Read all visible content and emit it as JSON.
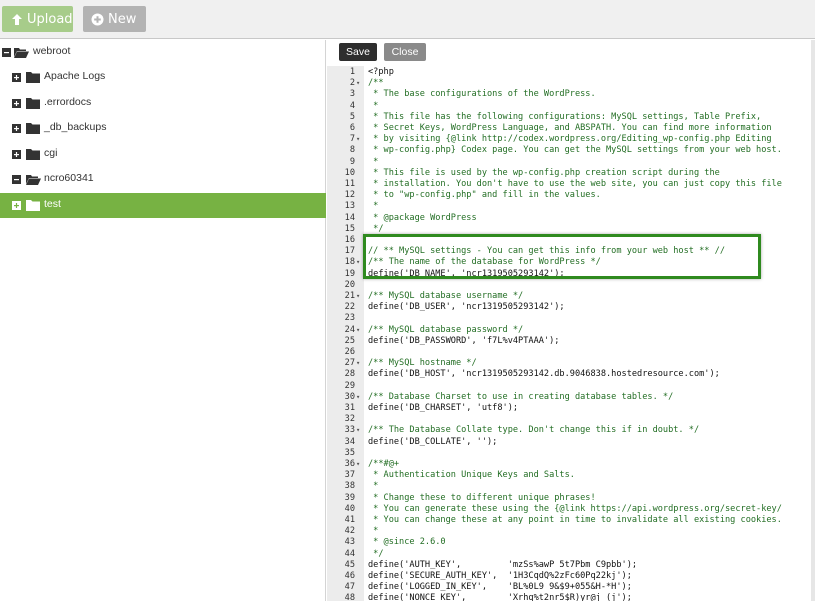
{
  "toolbar": {
    "upload_label": "Upload",
    "new_label": "New"
  },
  "tree": [
    {
      "label": "webroot",
      "level": 0,
      "open": true
    },
    {
      "label": "Apache Logs",
      "level": 1
    },
    {
      "label": ".errordocs",
      "level": 1
    },
    {
      "label": "_db_backups",
      "level": 1
    },
    {
      "label": "cgi",
      "level": 1
    },
    {
      "label": "ncro60341",
      "level": 1,
      "open": true
    },
    {
      "label": "test",
      "level": 1,
      "selected": true
    }
  ],
  "editor": {
    "save_label": "Save",
    "close_label": "Close"
  },
  "colors": {
    "accent": "#77b243",
    "highlight_border": "#2f8a1f",
    "comment": "#236e24"
  },
  "code": [
    {
      "n": "1",
      "f": "",
      "t": "<?php"
    },
    {
      "n": "2",
      "f": "▾",
      "t": "/**"
    },
    {
      "n": "3",
      "f": "",
      "t": " * The base configurations of the WordPress."
    },
    {
      "n": "4",
      "f": "",
      "t": " *"
    },
    {
      "n": "5",
      "f": "",
      "t": " * This file has the following configurations: MySQL settings, Table Prefix,"
    },
    {
      "n": "6",
      "f": "",
      "t": " * Secret Keys, WordPress Language, and ABSPATH. You can find more information"
    },
    {
      "n": "7",
      "f": "▾",
      "t": " * by visiting {@link http://codex.wordpress.org/Editing_wp-config.php Editing"
    },
    {
      "n": "8",
      "f": "",
      "t": " * wp-config.php} Codex page. You can get the MySQL settings from your web host."
    },
    {
      "n": "9",
      "f": "",
      "t": " *"
    },
    {
      "n": "10",
      "f": "",
      "t": " * This file is used by the wp-config.php creation script during the"
    },
    {
      "n": "11",
      "f": "",
      "t": " * installation. You don't have to use the web site, you can just copy this file"
    },
    {
      "n": "12",
      "f": "",
      "t": " * to \"wp-config.php\" and fill in the values."
    },
    {
      "n": "13",
      "f": "",
      "t": " *"
    },
    {
      "n": "14",
      "f": "",
      "t": " * @package WordPress"
    },
    {
      "n": "15",
      "f": "",
      "t": " */"
    },
    {
      "n": "16",
      "f": "",
      "t": ""
    },
    {
      "n": "17",
      "f": "",
      "t": "// ** MySQL settings - You can get this info from your web host ** //"
    },
    {
      "n": "18",
      "f": "▾",
      "t": "/** The name of the database for WordPress */"
    },
    {
      "n": "19",
      "f": "",
      "t": "define('DB_NAME', 'ncr1319505293142');"
    },
    {
      "n": "20",
      "f": "",
      "t": ""
    },
    {
      "n": "21",
      "f": "▾",
      "t": "/** MySQL database username */"
    },
    {
      "n": "22",
      "f": "",
      "t": "define('DB_USER', 'ncr1319505293142');"
    },
    {
      "n": "23",
      "f": "",
      "t": ""
    },
    {
      "n": "24",
      "f": "▾",
      "t": "/** MySQL database password */"
    },
    {
      "n": "25",
      "f": "",
      "t": "define('DB_PASSWORD', 'f7L%v4PTAAA');"
    },
    {
      "n": "26",
      "f": "",
      "t": ""
    },
    {
      "n": "27",
      "f": "▾",
      "t": "/** MySQL hostname */"
    },
    {
      "n": "28",
      "f": "",
      "t": "define('DB_HOST', 'ncr1319505293142.db.9046838.hostedresource.com');"
    },
    {
      "n": "29",
      "f": "",
      "t": ""
    },
    {
      "n": "30",
      "f": "▾",
      "t": "/** Database Charset to use in creating database tables. */"
    },
    {
      "n": "31",
      "f": "",
      "t": "define('DB_CHARSET', 'utf8');"
    },
    {
      "n": "32",
      "f": "",
      "t": ""
    },
    {
      "n": "33",
      "f": "▾",
      "t": "/** The Database Collate type. Don't change this if in doubt. */"
    },
    {
      "n": "34",
      "f": "",
      "t": "define('DB_COLLATE', '');"
    },
    {
      "n": "35",
      "f": "",
      "t": ""
    },
    {
      "n": "36",
      "f": "▾",
      "t": "/**#@+"
    },
    {
      "n": "37",
      "f": "",
      "t": " * Authentication Unique Keys and Salts."
    },
    {
      "n": "38",
      "f": "",
      "t": " *"
    },
    {
      "n": "39",
      "f": "",
      "t": " * Change these to different unique phrases!"
    },
    {
      "n": "40",
      "f": "",
      "t": " * You can generate these using the {@link https://api.wordpress.org/secret-key/"
    },
    {
      "n": "41",
      "f": "",
      "t": " * You can change these at any point in time to invalidate all existing cookies."
    },
    {
      "n": "42",
      "f": "",
      "t": " *"
    },
    {
      "n": "43",
      "f": "",
      "t": " * @since 2.6.0"
    },
    {
      "n": "44",
      "f": "",
      "t": " */"
    },
    {
      "n": "45",
      "f": "",
      "t": "define('AUTH_KEY',         'mzSs%awP 5t7Pbm C9pbb');"
    },
    {
      "n": "46",
      "f": "",
      "t": "define('SECURE_AUTH_KEY',  '1H3CqdQ%2zFc60Pq22kj');"
    },
    {
      "n": "47",
      "f": "",
      "t": "define('LOGGED_IN_KEY',    'BL%0L9 9&$9+055&H-*H');"
    },
    {
      "n": "48",
      "f": "",
      "t": "define('NONCE_KEY',        'Xrhq%t2nr5$R)yr@j_(j');"
    }
  ]
}
